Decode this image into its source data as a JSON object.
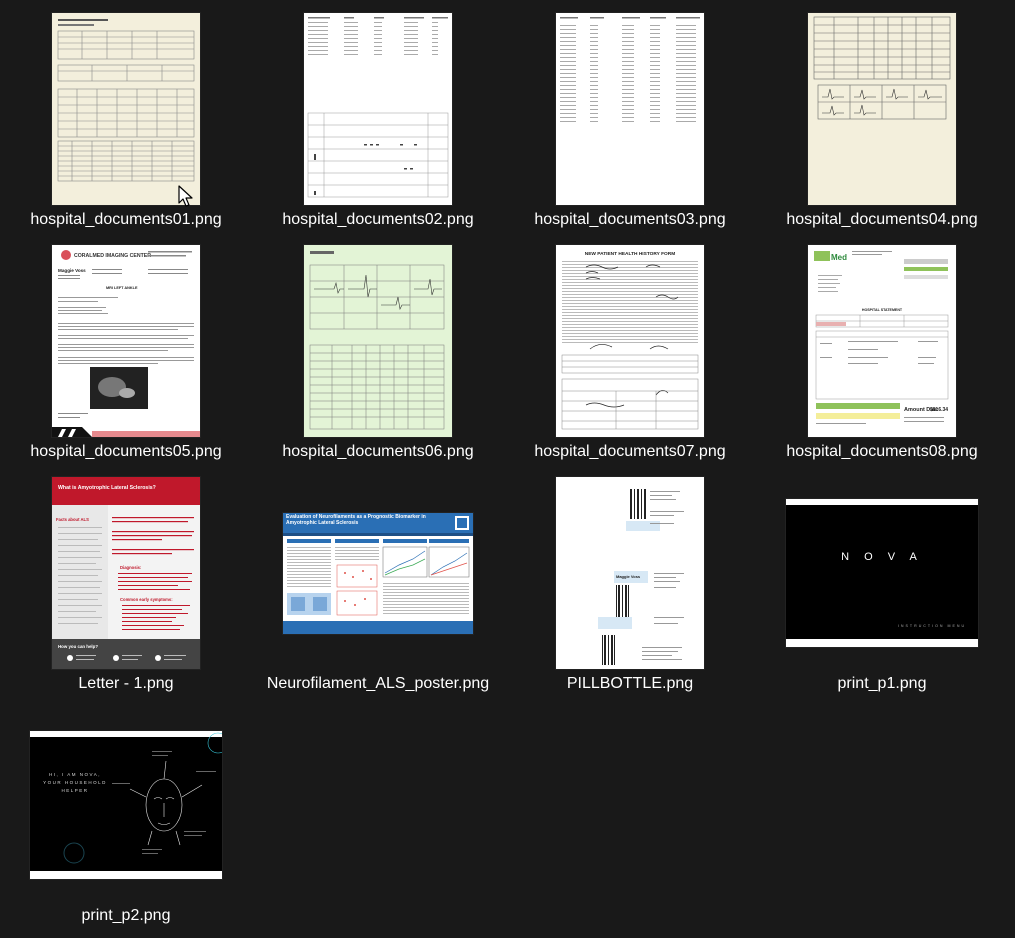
{
  "files": [
    {
      "name": "hospital_documents01.png"
    },
    {
      "name": "hospital_documents02.png"
    },
    {
      "name": "hospital_documents03.png"
    },
    {
      "name": "hospital_documents04.png"
    },
    {
      "name": "hospital_documents05.png"
    },
    {
      "name": "hospital_documents06.png"
    },
    {
      "name": "hospital_documents07.png"
    },
    {
      "name": "hospital_documents08.png"
    },
    {
      "name": "Letter - 1.png"
    },
    {
      "name": "Neurofilament_ALS_poster.png"
    },
    {
      "name": "PILLBOTTLE.png"
    },
    {
      "name": "print_p1.png"
    },
    {
      "name": "print_p2.png"
    }
  ],
  "thumb_text": {
    "coralmed_title": "CORALMED IMAGING CENTER",
    "patient_name": "Maggie Voss",
    "report_heading": "MRI LEFT ANKLE",
    "history_form_title": "NEW PATIENT HEALTH HISTORY FORM",
    "statement_title": "HOSPITAL STATEMENT",
    "amount_due_label": "Amount Due:",
    "amount_due_value": "$816.34",
    "als_heading": "What is Amyotrophic Lateral Sclerosis?",
    "als_facts": "Facts about ALS",
    "als_diagnosis": "Diagnosis:",
    "als_symptoms": "Common early symptoms:",
    "als_help": "How you can help?",
    "poster_title": "Evaluation of Neurofilaments as a Prognostic Biomarker in Amyotrophic Lateral Sclerosis",
    "nova_title": "N O V A",
    "nova_menu": "INSTRUCTION MENU",
    "nova_intro": "HI, I AM NOVA, YOUR HOUSEHOLD HELPER"
  },
  "colors": {
    "background": "#191919",
    "label_text": "#ffffff",
    "parchment": "#f3efdc",
    "green_grid": "#e3f4d6",
    "als_red": "#c0182b",
    "poster_blue": "#2a6fb5",
    "nova_cyan": "#37c6d8"
  }
}
